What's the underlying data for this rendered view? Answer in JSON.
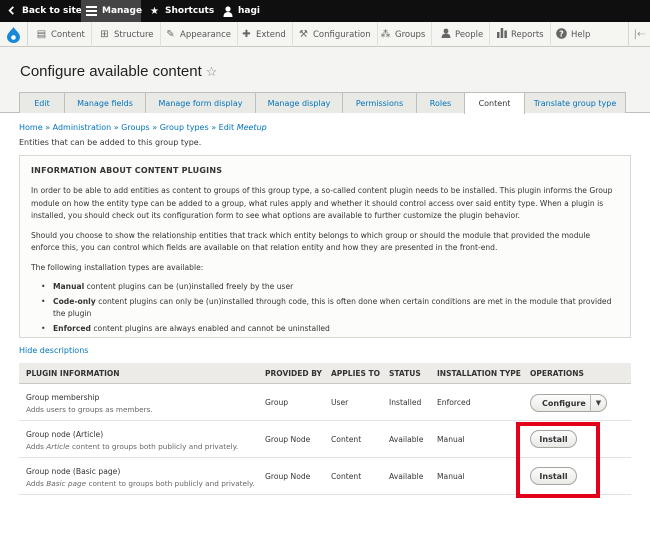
{
  "toolbar": {
    "back_to_site": "Back to site",
    "manage": "Manage",
    "shortcuts": "Shortcuts",
    "user": "hagi"
  },
  "admin_menu": {
    "content": "Content",
    "structure": "Structure",
    "appearance": "Appearance",
    "extend": "Extend",
    "configuration": "Configuration",
    "groups": "Groups",
    "people": "People",
    "reports": "Reports",
    "help": "Help"
  },
  "page": {
    "title": "Configure available content",
    "tabs": [
      {
        "label": "Edit"
      },
      {
        "label": "Manage fields"
      },
      {
        "label": "Manage form display"
      },
      {
        "label": "Manage display"
      },
      {
        "label": "Permissions"
      },
      {
        "label": "Roles"
      },
      {
        "label": "Content"
      },
      {
        "label": "Translate group type"
      }
    ],
    "active_tab": "Content"
  },
  "breadcrumb": {
    "home": "Home",
    "administration": "Administration",
    "groups": "Groups",
    "group_types": "Group types",
    "edit_prefix": "Edit",
    "edit_name": "Meetup",
    "separator": "»"
  },
  "intro": "Entities that can be added to this group type.",
  "info": {
    "heading": "INFORMATION ABOUT CONTENT PLUGINS",
    "p1": "In order to be able to add entities as content to groups of this group type, a so-called content plugin needs to be installed. This plugin informs the Group module on how the entity type can be added to a group, what rules apply and whether it should control access over said entity type. When a plugin is installed, you should check out its configuration form to see what options are available to further customize the plugin behavior.",
    "p2": "Should you choose to show the relationship entities that track which entity belongs to which group or should the module that provided the module enforce this, you can control which fields are available on that relation entity and how they are presented in the front-end.",
    "p3": "The following installation types are available:",
    "items": [
      {
        "term": "Manual",
        "text": "content plugins can be (un)installed freely by the user"
      },
      {
        "term": "Code-only",
        "text": "content plugins can only be (un)installed through code, this is often done when certain conditions are met in the module that provided the plugin"
      },
      {
        "term": "Enforced",
        "text": "content plugins are always enabled and cannot be uninstalled"
      }
    ]
  },
  "hide_descriptions": "Hide descriptions",
  "table": {
    "headers": [
      "PLUGIN INFORMATION",
      "PROVIDED BY",
      "APPLIES TO",
      "STATUS",
      "INSTALLATION TYPE",
      "OPERATIONS"
    ],
    "rows": [
      {
        "name": "Group membership",
        "desc_pre": "Adds users to groups as members.",
        "desc_em": "",
        "desc_post": "",
        "provided_by": "Group",
        "applies_to": "User",
        "status": "Installed",
        "install_type": "Enforced",
        "operation": "Configure"
      },
      {
        "name": "Group node (Article)",
        "desc_pre": "Adds ",
        "desc_em": "Article",
        "desc_post": " content to groups both publicly and privately.",
        "provided_by": "Group Node",
        "applies_to": "Content",
        "status": "Available",
        "install_type": "Manual",
        "operation": "Install"
      },
      {
        "name": "Group node (Basic page)",
        "desc_pre": "Adds ",
        "desc_em": "Basic page",
        "desc_post": " content to groups both publicly and privately.",
        "provided_by": "Group Node",
        "applies_to": "Content",
        "status": "Available",
        "install_type": "Manual",
        "operation": "Install"
      }
    ]
  },
  "colors": {
    "link": "#0074bd",
    "highlight": "#e3001b",
    "toolbar_bg": "#0f0f0f",
    "drupal_blue": "#1a88d8"
  },
  "icons": {
    "back": "chevron-left-icon",
    "manage": "hamburger-icon",
    "shortcuts": "star-icon",
    "user": "person-icon",
    "logo": "drupal-drop-icon"
  }
}
